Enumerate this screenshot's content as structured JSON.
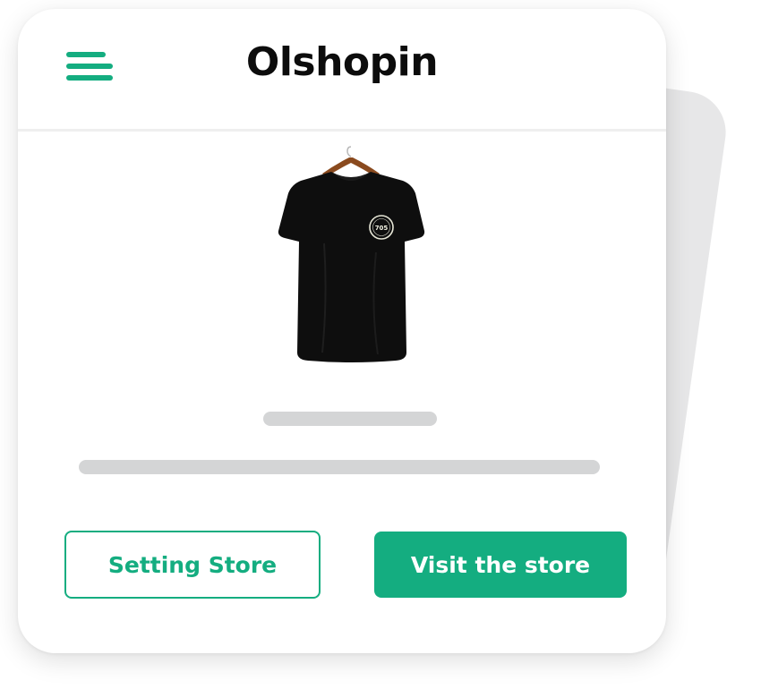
{
  "header": {
    "brand": "Olshopin",
    "menu_icon": "hamburger-menu-icon"
  },
  "product": {
    "image_icon": "black-tshirt-on-hanger",
    "badge_text": "705"
  },
  "actions": {
    "setting_store_label": "Setting Store",
    "visit_store_label": "Visit the store"
  },
  "colors": {
    "accent": "#14ad80",
    "skeleton": "#d4d5d6",
    "back_card": "#e7e7e8",
    "text": "#0c0c0c"
  }
}
